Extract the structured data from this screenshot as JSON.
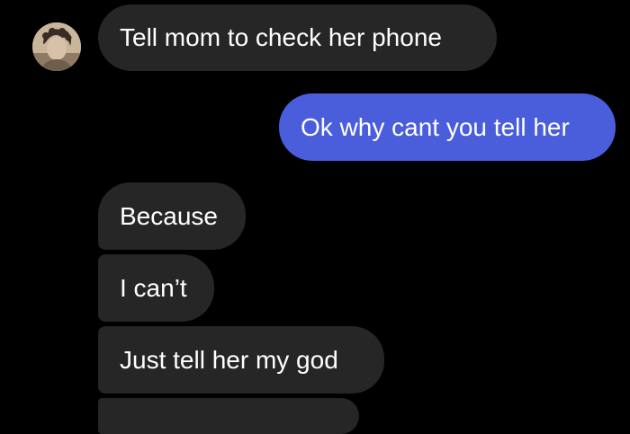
{
  "conversation": {
    "contact": {
      "avatar_icon": "profile-photo"
    },
    "messages": [
      {
        "direction": "incoming",
        "text": "Tell mom to check her phone"
      },
      {
        "direction": "outgoing",
        "text": "Ok why cant you tell her"
      },
      {
        "direction": "incoming",
        "text": "Because"
      },
      {
        "direction": "incoming",
        "text": "I can’t"
      },
      {
        "direction": "incoming",
        "text": "Just tell her my god"
      },
      {
        "direction": "incoming",
        "text": ""
      }
    ]
  },
  "colors": {
    "background": "#000000",
    "incoming_bubble": "#262626",
    "outgoing_bubble": "#4a5ddb",
    "text": "#ffffff"
  }
}
